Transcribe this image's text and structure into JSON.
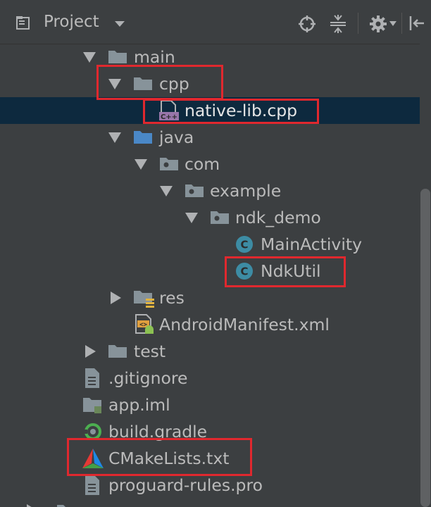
{
  "header": {
    "title": "Project",
    "icons": [
      "project-view-icon",
      "dropdown-caret-icon",
      "locate-icon",
      "collapse-all-icon",
      "settings-icon",
      "hide-panel-icon"
    ]
  },
  "tree": {
    "items": [
      {
        "name": "main",
        "type": "folder",
        "expanded": true
      },
      {
        "name": "cpp",
        "type": "folder",
        "expanded": true
      },
      {
        "name": "native-lib.cpp",
        "type": "cpp-file",
        "selected": true
      },
      {
        "name": "java",
        "type": "source-folder",
        "expanded": true
      },
      {
        "name": "com",
        "type": "package",
        "expanded": true
      },
      {
        "name": "example",
        "type": "package",
        "expanded": true
      },
      {
        "name": "ndk_demo",
        "type": "package",
        "expanded": true
      },
      {
        "name": "MainActivity",
        "type": "class"
      },
      {
        "name": "NdkUtil",
        "type": "class"
      },
      {
        "name": "res",
        "type": "resource-folder",
        "expanded": false
      },
      {
        "name": "AndroidManifest.xml",
        "type": "manifest"
      },
      {
        "name": "test",
        "type": "folder",
        "expanded": false
      },
      {
        "name": ".gitignore",
        "type": "text-file"
      },
      {
        "name": "app.iml",
        "type": "module-file"
      },
      {
        "name": "build.gradle",
        "type": "gradle-file"
      },
      {
        "name": "CMakeLists.txt",
        "type": "cmake-file"
      },
      {
        "name": "proguard-rules.pro",
        "type": "text-file"
      }
    ]
  },
  "colors": {
    "background": "#3c3f41",
    "selection": "#0d293e",
    "highlight_box": "#e0282e",
    "text": "#bbbbbb",
    "class_icon": "#3d8ca4"
  }
}
